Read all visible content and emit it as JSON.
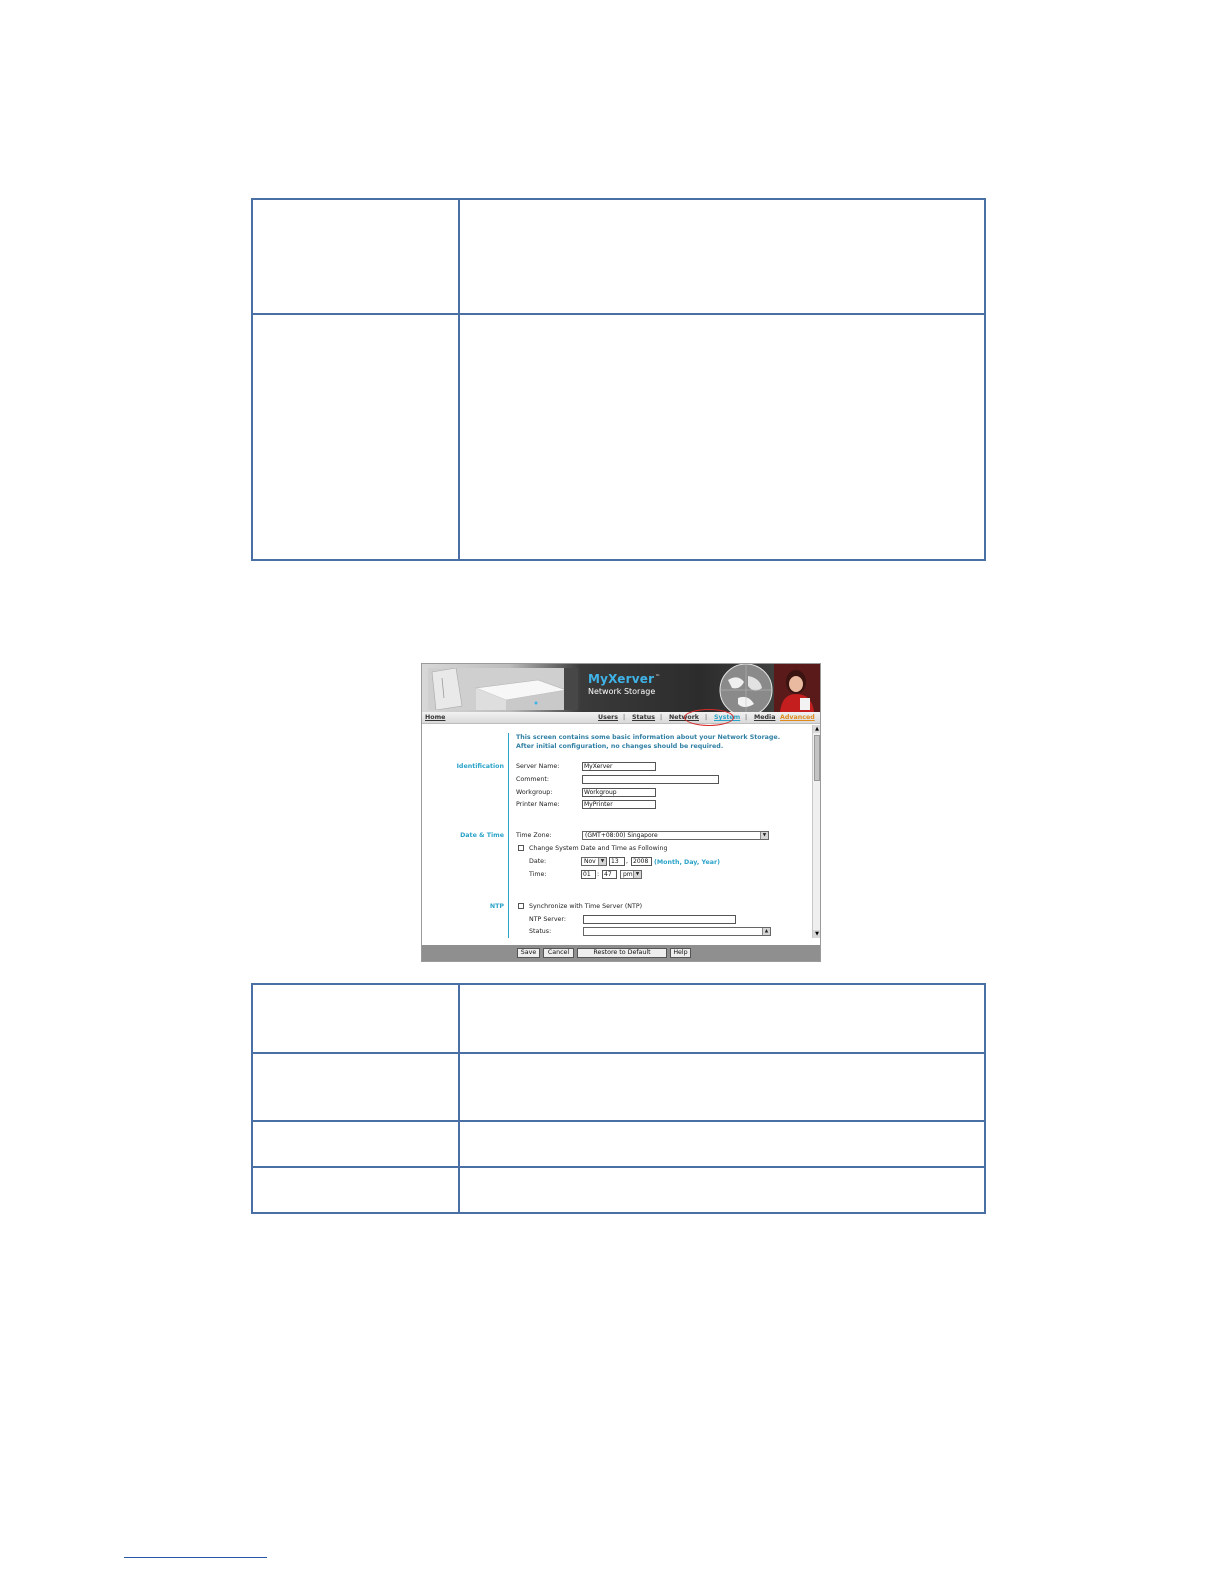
{
  "screenshot": {
    "brand": {
      "title": "MyXerver",
      "tm": "™",
      "subtitle": "Network Storage"
    },
    "nav": {
      "home": "Home",
      "users": "Users",
      "status": "Status",
      "network": "Network",
      "system": "System",
      "media": "Media",
      "advanced": "Advanced",
      "separator": "|"
    },
    "intro": {
      "line1": "This screen contains some basic information about your Network Storage.",
      "line2": "After initial configuration, no changes should be required."
    },
    "identification": {
      "section_label": "Identification",
      "server_name_label": "Server Name:",
      "server_name_value": "MyXerver",
      "comment_label": "Comment:",
      "comment_value": "",
      "workgroup_label": "Workgroup:",
      "workgroup_value": "Workgroup",
      "printer_name_label": "Printer Name:",
      "printer_name_value": "MyPrinter"
    },
    "date_time": {
      "section_label": "Date & Time",
      "time_zone_label": "Time Zone:",
      "time_zone_value": "(GMT+08:00) Singapore",
      "change_checkbox_label": "Change System Date and Time as Following",
      "change_checked": false,
      "date_label": "Date:",
      "month": "Nov",
      "day": "13",
      "year": "2008",
      "date_format_hint": "(Month, Day, Year)",
      "time_label": "Time:",
      "hour": "01",
      "minute": "47",
      "ampm": "pm",
      "date_separator": ",",
      "time_separator": ":"
    },
    "ntp": {
      "section_label": "NTP",
      "sync_checkbox_label": "Synchronize with Time Server (NTP)",
      "sync_checked": false,
      "server_label": "NTP Server:",
      "server_value": "",
      "status_label": "Status:",
      "status_value": ""
    },
    "buttons": {
      "save": "Save",
      "cancel": "Cancel",
      "restore": "Restore to Default",
      "help": "Help"
    },
    "icons": {
      "select_arrow": "dropdown-arrow-icon",
      "scroll_up": "scroll-up-arrow-icon",
      "scroll_down": "scroll-down-arrow-icon"
    },
    "colors": {
      "accent": "#2aa3c8",
      "advanced_link": "#e08a1c",
      "highlight_ring": "#d42a2a",
      "table_border": "#4a6fa5"
    }
  }
}
